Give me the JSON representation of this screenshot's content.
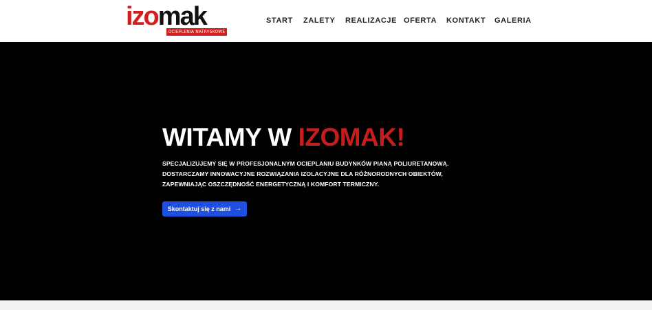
{
  "header": {
    "logo": {
      "word_red": "izo",
      "word_dark": "mak",
      "tagline": "OCIEPLENIA NATRYSKOWE"
    },
    "nav": [
      {
        "label": "START"
      },
      {
        "label": "ZALETY"
      },
      {
        "label": "REALIZACJE"
      },
      {
        "label": "OFERTA"
      },
      {
        "label": "KONTAKT"
      },
      {
        "label": "GALERIA"
      }
    ]
  },
  "hero": {
    "title_prefix": "WITAMY W ",
    "title_accent": "IZOMAK!",
    "description_lines": [
      "SPECJALIZUJEMY SIĘ W PROFESJONALNYM OCIEPLANIU BUDYNKÓW PIANĄ POLIURETANOWĄ.",
      "DOSTARCZAMY INNOWACYJNE ROZWIĄZANIA IZOLACYJNE DLA RÓŻNORODNYCH OBIEKTÓW,",
      "ZAPEWNIAJĄC OSZCZĘDNOŚĆ ENERGETYCZNĄ I KOMFORT TERMICZNY."
    ],
    "cta_label": "Skontaktuj się z nami",
    "cta_icon": "arrow-right-icon"
  },
  "colors": {
    "brand_red": "#d51d1d",
    "accent_red": "#c41e1e",
    "cta_blue": "#1f4fe0",
    "hero_bg": "#000000"
  }
}
